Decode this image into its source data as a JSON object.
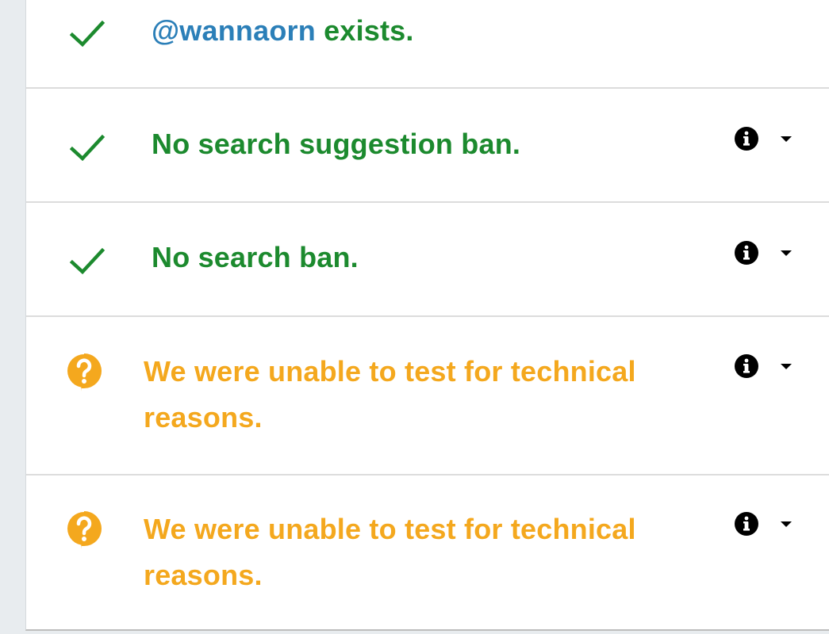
{
  "colors": {
    "success": "#1c8a2e",
    "warning": "#f4a81e",
    "link": "#2b7fb8",
    "divider": "#dcdcdc"
  },
  "rows": [
    {
      "status": "success",
      "icon": "checkmark-icon",
      "handle": "@wannaorn",
      "text": " exists.",
      "has_details": false
    },
    {
      "status": "success",
      "icon": "checkmark-icon",
      "text": "No search suggestion ban.",
      "has_details": true
    },
    {
      "status": "success",
      "icon": "checkmark-icon",
      "text": "No search ban.",
      "has_details": true
    },
    {
      "status": "unknown",
      "icon": "question-bubble-icon",
      "text": "We were unable to test for technical reasons.",
      "has_details": true
    },
    {
      "status": "unknown",
      "icon": "question-bubble-icon",
      "text": "We were unable to test for technical reasons.",
      "has_details": true
    }
  ]
}
